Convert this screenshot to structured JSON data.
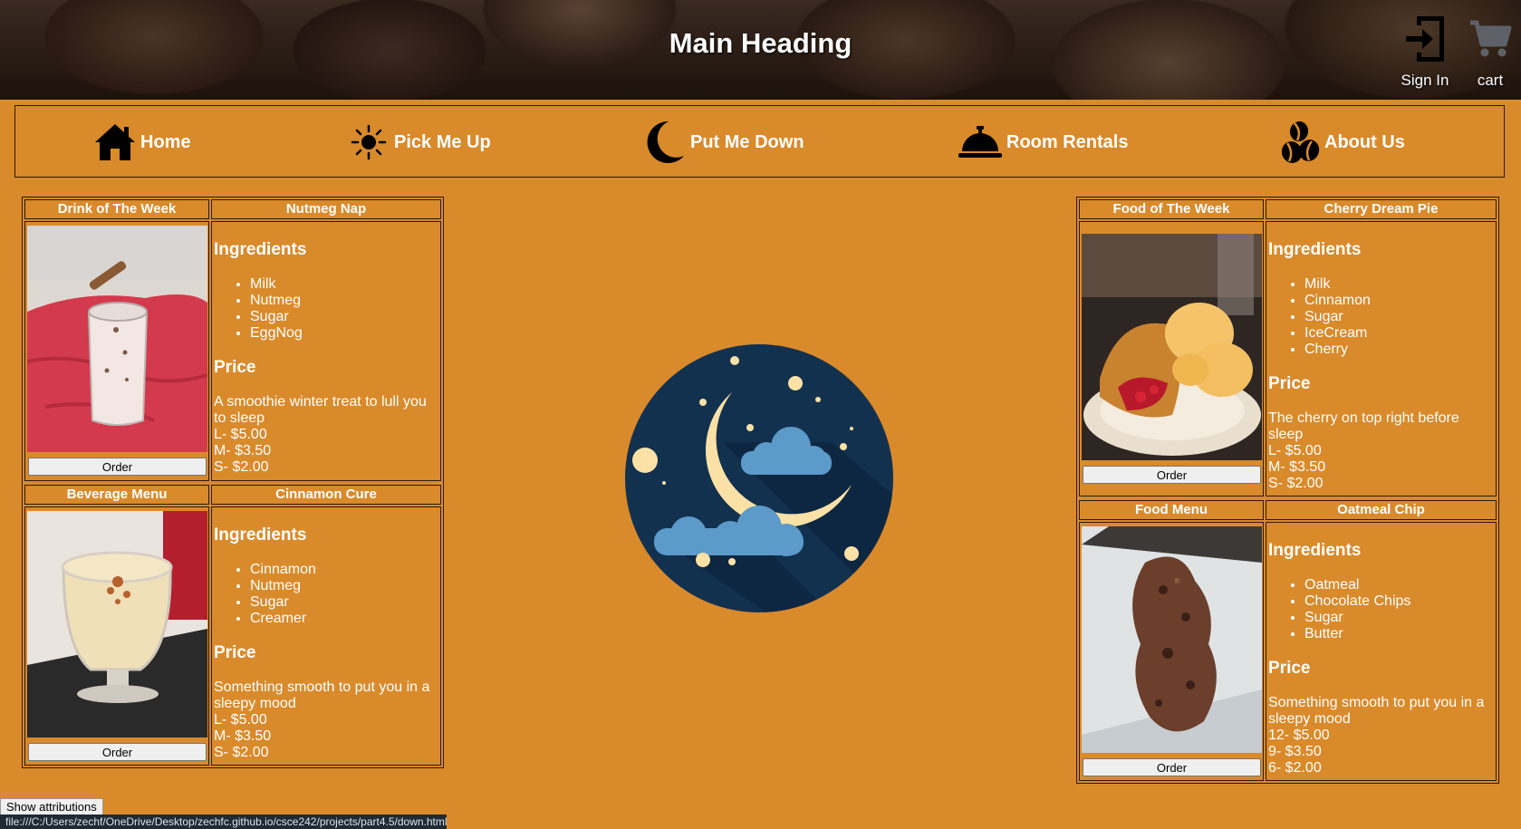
{
  "header": {
    "title": "Main Heading",
    "sign_in": "Sign In",
    "cart": "cart"
  },
  "nav": [
    {
      "label": "Home",
      "icon": "home-icon"
    },
    {
      "label": "Pick Me Up",
      "icon": "sun-icon"
    },
    {
      "label": "Put Me Down",
      "icon": "moon-icon"
    },
    {
      "label": "Room Rentals",
      "icon": "service-bell-icon"
    },
    {
      "label": "About Us",
      "icon": "coffee-beans-icon"
    }
  ],
  "left": {
    "drink_week": {
      "header": "Drink of The Week",
      "name": "Nutmeg Nap",
      "ingredients_title": "Ingredients",
      "ingredients": [
        "Milk",
        "Nutmeg",
        "Sugar",
        "EggNog"
      ],
      "price_title": "Price",
      "description": "A smoothie winter treat to lull you to sleep",
      "prices": [
        "L- $5.00",
        "M- $3.50",
        "S- $2.00"
      ],
      "order": "Order"
    },
    "beverage_menu": {
      "header": "Beverage Menu",
      "name": "Cinnamon Cure",
      "ingredients_title": "Ingredients",
      "ingredients": [
        "Cinnamon",
        "Nutmeg",
        "Sugar",
        "Creamer"
      ],
      "price_title": "Price",
      "description": "Something smooth to put you in a sleepy mood",
      "prices": [
        "L- $5.00",
        "M- $3.50",
        "S- $2.00"
      ],
      "order": "Order"
    }
  },
  "right": {
    "food_week": {
      "header": "Food of The Week",
      "name": "Cherry Dream Pie",
      "ingredients_title": "Ingredients",
      "ingredients": [
        "Milk",
        "Cinnamon",
        "Sugar",
        "IceCream",
        "Cherry"
      ],
      "price_title": "Price",
      "description": "The cherry on top right before sleep",
      "prices": [
        "L- $5.00",
        "M- $3.50",
        "S- $2.00"
      ],
      "order": "Order"
    },
    "food_menu": {
      "header": "Food Menu",
      "name": "Oatmeal Chip",
      "ingredients_title": "Ingredients",
      "ingredients": [
        "Oatmeal",
        "Chocolate Chips",
        "Sugar",
        "Butter"
      ],
      "price_title": "Price",
      "description": "Something smooth to put you in a sleepy mood",
      "prices": [
        "12- $5.00",
        "9- $3.50",
        "6- $2.00"
      ],
      "order": "Order"
    }
  },
  "footer": {
    "attributions_button": "Show attributions",
    "status_url": "file:///C:/Users/zechf/OneDrive/Desktop/zechfc.github.io/csce242/projects/part4.5/down.html"
  },
  "colors": {
    "background": "#d98a2b",
    "border": "#2d1a08",
    "moon_circle": "#12314f",
    "moon": "#fbe1a6",
    "cloud": "#5b9ac9"
  }
}
